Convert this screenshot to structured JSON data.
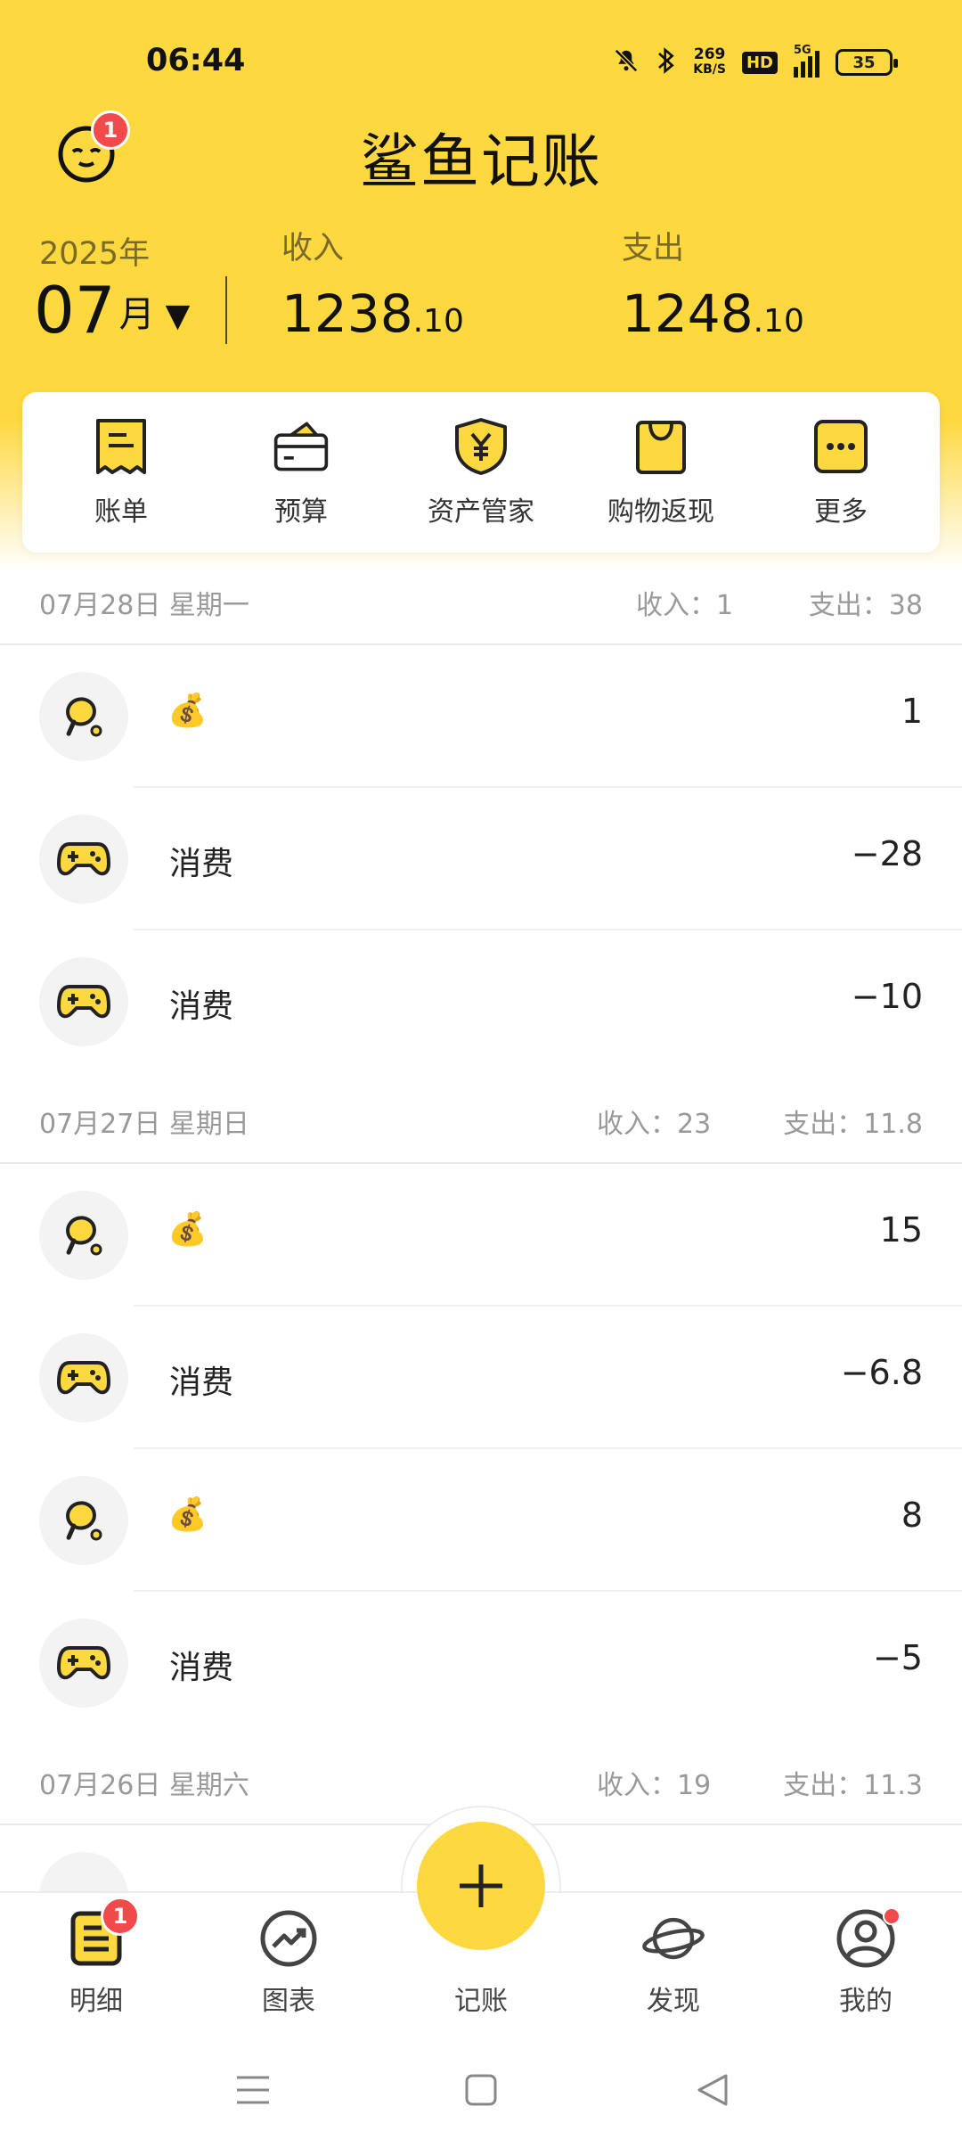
{
  "status_bar": {
    "time": "06:44",
    "net_speed_value": "269",
    "net_speed_unit": "KB/S",
    "hd_label": "HD",
    "network_label": "5G",
    "battery_level": "35"
  },
  "header": {
    "title": "鲨鱼记账",
    "notification_count": "1"
  },
  "summary": {
    "year": "2025年",
    "month": "07",
    "month_unit": "月",
    "income_label": "收入",
    "income_int": "1238",
    "income_dec": ".10",
    "expense_label": "支出",
    "expense_int": "1248",
    "expense_dec": ".10"
  },
  "quick_menu": {
    "items": [
      {
        "label": "账单",
        "icon": "receipt-icon"
      },
      {
        "label": "预算",
        "icon": "wallet-icon"
      },
      {
        "label": "资产管家",
        "icon": "shield-yen-icon"
      },
      {
        "label": "购物返现",
        "icon": "shopping-bag-icon"
      },
      {
        "label": "更多",
        "icon": "more-icon"
      }
    ]
  },
  "days": [
    {
      "date": "07月28日 星期一",
      "income": "收入：1",
      "expense": "支出：38",
      "rows": [
        {
          "title": "",
          "emoji": "💰",
          "amount": "1",
          "icon": "ping-pong-icon"
        },
        {
          "title": "消费",
          "emoji": "",
          "amount": "−28",
          "icon": "gamepad-icon"
        },
        {
          "title": "消费",
          "emoji": "",
          "amount": "−10",
          "icon": "gamepad-icon"
        }
      ]
    },
    {
      "date": "07月27日 星期日",
      "income": "收入：23",
      "expense": "支出：11.8",
      "rows": [
        {
          "title": "",
          "emoji": "💰",
          "amount": "15",
          "icon": "ping-pong-icon"
        },
        {
          "title": "消费",
          "emoji": "",
          "amount": "−6.8",
          "icon": "gamepad-icon"
        },
        {
          "title": "",
          "emoji": "💰",
          "amount": "8",
          "icon": "ping-pong-icon"
        },
        {
          "title": "消费",
          "emoji": "",
          "amount": "−5",
          "icon": "gamepad-icon"
        }
      ]
    },
    {
      "date": "07月26日 星期六",
      "income": "收入：19",
      "expense": "支出：11.3",
      "rows": []
    }
  ],
  "bottom_nav": {
    "items": [
      {
        "label": "明细",
        "icon": "detail-list-icon",
        "badge": "1"
      },
      {
        "label": "图表",
        "icon": "chart-trend-icon"
      },
      {
        "label": "记账",
        "icon": "plus-icon"
      },
      {
        "label": "发现",
        "icon": "planet-icon"
      },
      {
        "label": "我的",
        "icon": "profile-icon"
      }
    ]
  },
  "colors": {
    "brand_yellow": "#fdd83f",
    "badge_red": "#f04a4a"
  }
}
